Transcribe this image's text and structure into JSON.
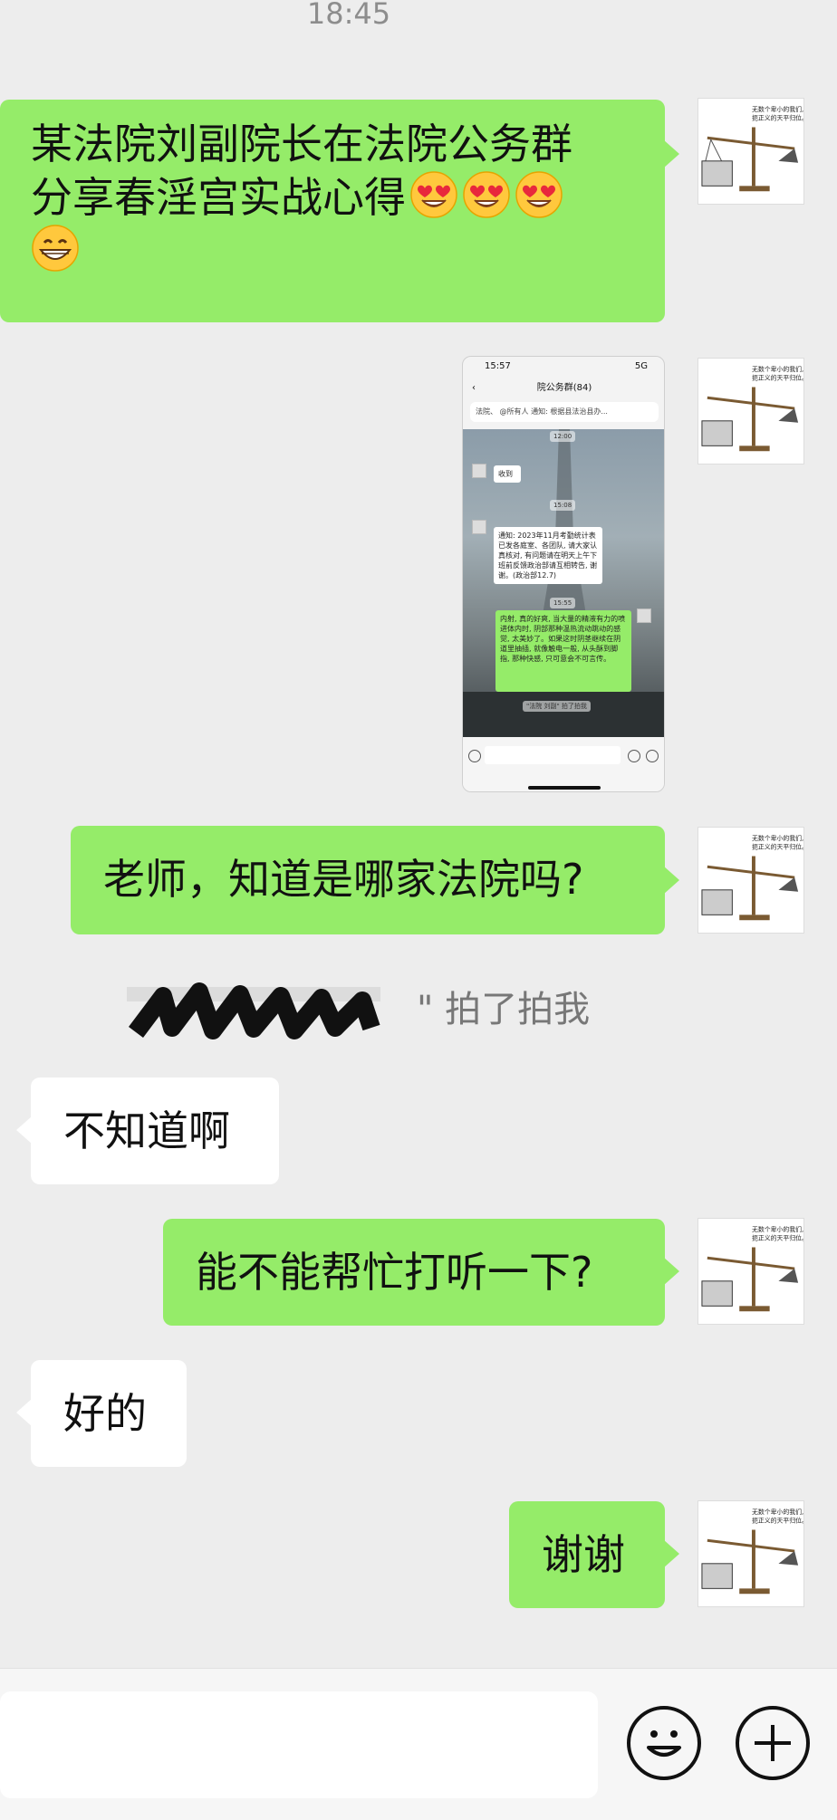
{
  "status": {
    "time": "18:45"
  },
  "messages": [
    {
      "text": "某法院刘副院长在法院公务群",
      "line2": "分享春淫宫实战心得",
      "emojis": [
        "heart-eyes-icon",
        "heart-eyes-icon",
        "heart-eyes-icon",
        "grinning-icon"
      ]
    },
    {
      "text": "老师，知道是哪家法院吗?"
    },
    {
      "text": "不知道啊"
    },
    {
      "text": "能不能帮忙打听一下?"
    },
    {
      "text": "好的"
    },
    {
      "text": "谢谢"
    }
  ],
  "pat_notice": "\" 拍了拍我",
  "avatar_caption": [
    "无数个卑小的我们,",
    "扼正义的天平归位。"
  ],
  "screenshot": {
    "status_time": "15:57",
    "status_right": "5G",
    "header_title": "院公务群(84)",
    "notice_text": "法院、 @所有人 通知: 根据县法治县办...",
    "times": [
      "12:00",
      "15:08",
      "15:55"
    ],
    "msg1": "收到",
    "msg2": "通知: 2023年11月考勤统计表已发各庭室、各团队, 请大家认真核对, 有问题请在明天上午下班前反馈政治部请互相转告, 谢谢。(政治部12.7)",
    "msg3": "内射, 真的好爽, 当大量的精液有力的喷进体内时, 阴部那种温热流动跳动的感觉, 太美妙了。如果这时阴茎继续在阴道里抽插, 就像触电一般, 从头酥到脚指, 那种快感, 只可意会不可言传。",
    "pat_text": "\"法院 刘副\" 拍了拍我"
  },
  "colors": {
    "background": "#ededed",
    "bubble_mine": "#95ec69",
    "bubble_other": "#ffffff",
    "timestamp": "#8d8d8d"
  }
}
